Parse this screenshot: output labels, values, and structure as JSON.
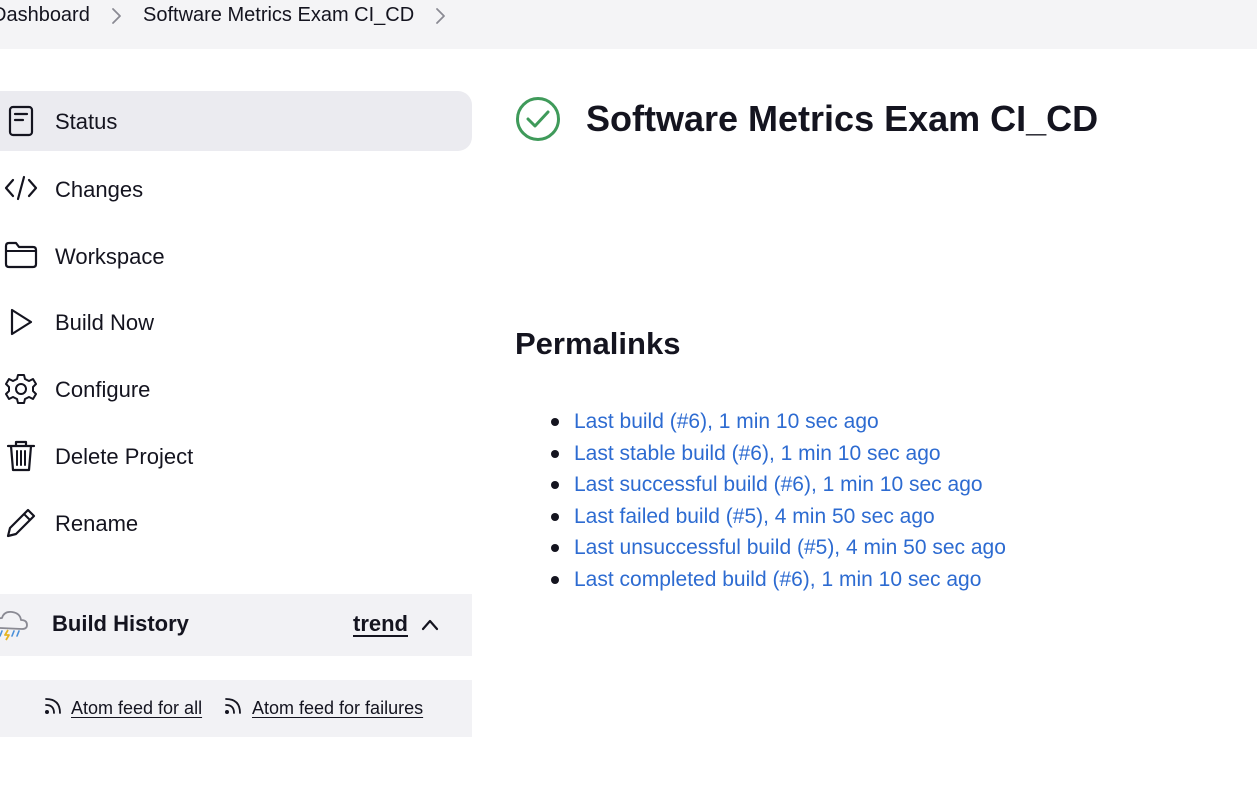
{
  "breadcrumb": {
    "items": [
      "Dashboard",
      "Software Metrics Exam CI_CD"
    ]
  },
  "sidebar": {
    "items": [
      {
        "label": "Status",
        "icon": "status-document-icon",
        "active": true
      },
      {
        "label": "Changes",
        "icon": "code-icon"
      },
      {
        "label": "Workspace",
        "icon": "folder-icon"
      },
      {
        "label": "Build Now",
        "icon": "play-icon"
      },
      {
        "label": "Configure",
        "icon": "gear-icon"
      },
      {
        "label": "Delete Project",
        "icon": "trash-icon"
      },
      {
        "label": "Rename",
        "icon": "pencil-icon"
      }
    ]
  },
  "build_history": {
    "title": "Build History",
    "trend_label": "trend",
    "icon": "weather-storm-icon",
    "feeds": [
      "Atom feed for all",
      "Atom feed for failures"
    ]
  },
  "main": {
    "title": "Software Metrics Exam CI_CD",
    "status_icon": "success-check-icon",
    "permalinks_heading": "Permalinks",
    "permalinks": [
      "Last build (#6), 1 min 10 sec ago",
      "Last stable build (#6), 1 min 10 sec ago",
      "Last successful build (#6), 1 min 10 sec ago",
      "Last failed build (#5), 4 min 50 sec ago",
      "Last unsuccessful build (#5), 4 min 50 sec ago",
      "Last completed build (#6), 1 min 10 sec ago"
    ]
  },
  "colors": {
    "link": "#2d6bd1",
    "success": "#3f9a5a",
    "active_bg": "#ebebf0",
    "breadcrumb_bg": "#f4f4f6"
  }
}
